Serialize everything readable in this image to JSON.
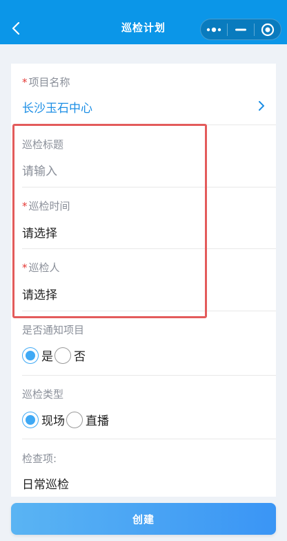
{
  "nav": {
    "title": "巡检计划"
  },
  "form": {
    "project": {
      "label": "项目名称",
      "value": "长沙玉石中心"
    },
    "inspection_title": {
      "label": "巡检标题",
      "placeholder": "请输入"
    },
    "inspection_time": {
      "label": "巡检时间",
      "value": "请选择"
    },
    "inspector": {
      "label": "巡检人",
      "value": "请选择"
    },
    "notify_project": {
      "label": "是否通知项目",
      "options": [
        "是",
        "否"
      ],
      "selected": "是"
    },
    "inspection_type": {
      "label": "巡检类型",
      "options": [
        "现场",
        "直播"
      ],
      "selected": "现场"
    },
    "check_items": {
      "label": "检查项:",
      "value": "日常巡检"
    }
  },
  "actions": {
    "create_label": "创建"
  },
  "colors": {
    "nav_bg": "#0b96e8",
    "accent": "#3fa9f5",
    "required": "#e53935",
    "highlight": "#e35b5b"
  }
}
